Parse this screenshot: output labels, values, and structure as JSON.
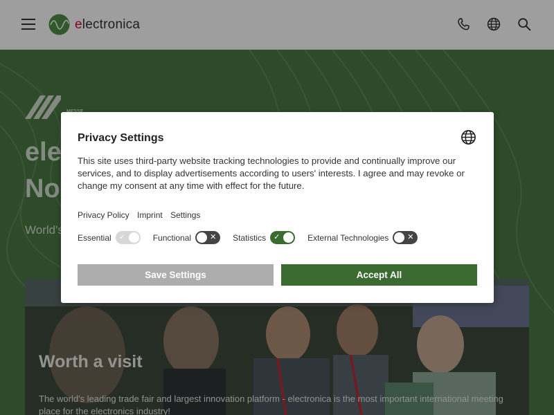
{
  "header": {
    "brand_prefix": "e",
    "brand_rest": "lectronica",
    "icons": [
      "menu-icon",
      "phone-icon",
      "globe-icon",
      "search-icon"
    ]
  },
  "hero": {
    "logo_small_text": "MESSE",
    "title_line1": "ele",
    "title_line2": "No",
    "subtitle": "World's",
    "card": {
      "title": "Worth a visit",
      "text": "The world's leading trade fair and largest innovation platform - electronica is the most important international meeting place for the electronics industry!"
    }
  },
  "modal": {
    "title": "Privacy Settings",
    "description": "This site uses third-party website tracking technologies to provide and continually improve our services, and to display advertisements according to users' interests. I agree and may revoke or change my consent at any time with effect for the future.",
    "links": [
      "Privacy Policy",
      "Imprint",
      "Settings"
    ],
    "toggles": [
      {
        "label": "Essential",
        "state": "on-disabled"
      },
      {
        "label": "Functional",
        "state": "off"
      },
      {
        "label": "Statistics",
        "state": "on"
      },
      {
        "label": "External Technologies",
        "state": "off"
      }
    ],
    "save_label": "Save Settings",
    "accept_label": "Accept All"
  },
  "colors": {
    "brand_green": "#3b6b30",
    "brand_red": "#c8102e",
    "button_gray": "#adadad",
    "hero_green": "#4a7a43"
  }
}
